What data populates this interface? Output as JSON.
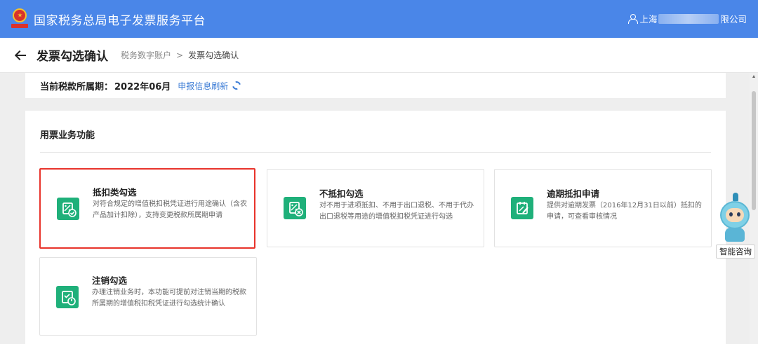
{
  "header": {
    "app_title": "国家税务总局电子发票服务平台",
    "user_prefix": "上海",
    "user_suffix": "限公司"
  },
  "subheader": {
    "page_title": "发票勾选确认",
    "breadcrumb_parent": "税务数字账户",
    "breadcrumb_separator": ">",
    "breadcrumb_current": "发票勾选确认"
  },
  "period": {
    "label": "当前税款所属期：",
    "value": "2022年06月",
    "refresh_link": "申报信息刷新"
  },
  "functions": {
    "section_title": "用票业务功能",
    "cards": [
      {
        "title": "抵扣类勾选",
        "description": "对符合规定的增值税扣税凭证进行用途确认（含农产品加计扣除），支持变更税款所属期申请",
        "icon": "deduction-select-icon",
        "selected": true
      },
      {
        "title": "不抵扣勾选",
        "description": "对不用于进项抵扣、不用于出口退税、不用于代办出口退税等用途的增值税扣税凭证进行勾选",
        "icon": "non-deduction-select-icon",
        "selected": false
      },
      {
        "title": "逾期抵扣申请",
        "description": "提供对逾期发票（2016年12月31日以前）抵扣的申请，可查看审核情况",
        "icon": "overdue-deduction-icon",
        "selected": false
      },
      {
        "title": "注销勾选",
        "description": "办理注销业务时，本功能可提前对注销当期的税款所属期的增值税扣税凭证进行勾选统计确认",
        "icon": "cancellation-select-icon",
        "selected": false
      }
    ]
  },
  "assistant": {
    "label": "智能咨询"
  },
  "colors": {
    "header_blue": "#4a86e8",
    "icon_green": "#1fb07a",
    "selected_border": "#e8332b",
    "link_blue": "#3a7bd5"
  }
}
